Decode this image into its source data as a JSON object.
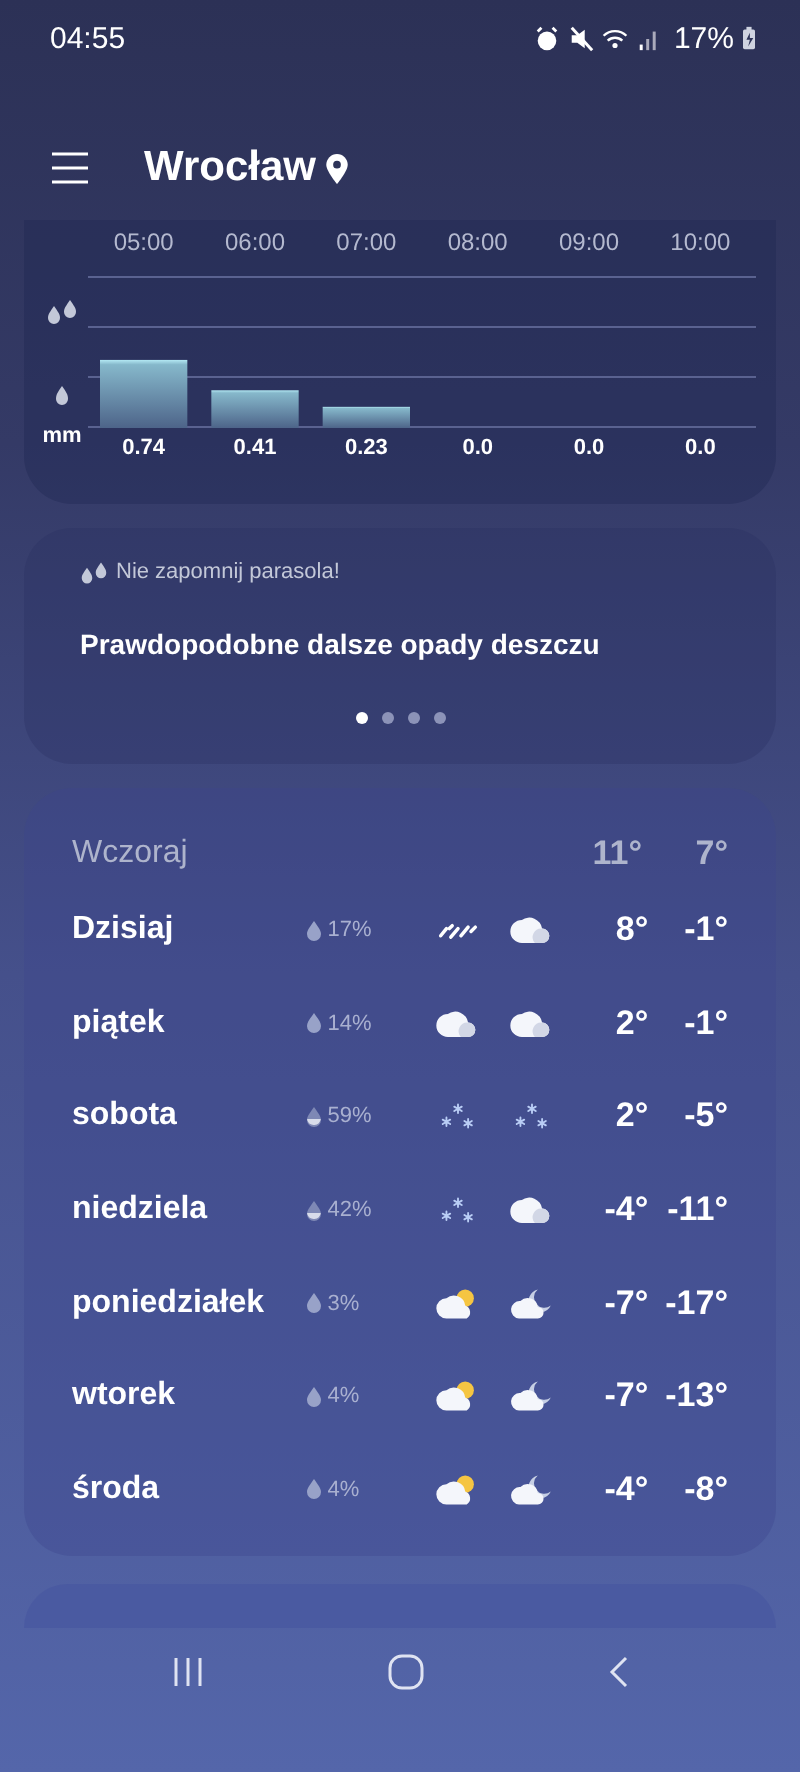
{
  "status_bar": {
    "time": "04:55",
    "battery": "17%"
  },
  "header": {
    "city": "Wrocław"
  },
  "precipitation": {
    "chart_data": {
      "type": "bar",
      "ylabel": "mm",
      "categories": [
        "05:00",
        "06:00",
        "07:00",
        "08:00",
        "09:00",
        "10:00"
      ],
      "values": [
        0.74,
        0.41,
        0.23,
        0.0,
        0.0,
        0.0
      ],
      "value_labels": [
        "0.74",
        "0.41",
        "0.23",
        "0.0",
        "0.0",
        "0.0"
      ],
      "data_labels": true
    }
  },
  "alert": {
    "title": "Nie zapomnij parasola!",
    "message": "Prawdopodobne dalsze opady deszczu",
    "pages": [
      {
        "selected": true
      },
      {
        "selected": false
      },
      {
        "selected": false
      },
      {
        "selected": false
      }
    ]
  },
  "yesterday": {
    "label": "Wczoraj",
    "high": "11°",
    "low": "7°"
  },
  "forecast": [
    {
      "day": "Dzisiaj",
      "precip": {
        "kind": "drop",
        "chance": "17%"
      },
      "day_icon": {
        "kind": "rain"
      },
      "night_icon": {
        "kind": "cloud"
      },
      "high": "8°",
      "low": "-1°"
    },
    {
      "day": "piątek",
      "precip": {
        "kind": "drop",
        "chance": "14%"
      },
      "day_icon": {
        "kind": "cloud"
      },
      "night_icon": {
        "kind": "cloud"
      },
      "high": "2°",
      "low": "-1°"
    },
    {
      "day": "sobota",
      "precip": {
        "kind": "half-drop",
        "chance": "59%"
      },
      "day_icon": {
        "kind": "snow"
      },
      "night_icon": {
        "kind": "snow"
      },
      "high": "2°",
      "low": "-5°"
    },
    {
      "day": "niedziela",
      "precip": {
        "kind": "half-drop",
        "chance": "42%"
      },
      "day_icon": {
        "kind": "snow"
      },
      "night_icon": {
        "kind": "cloud"
      },
      "high": "-4°",
      "low": "-11°"
    },
    {
      "day": "poniedziałek",
      "precip": {
        "kind": "drop",
        "chance": "3%"
      },
      "day_icon": {
        "kind": "sun-cloud"
      },
      "night_icon": {
        "kind": "moon-cloud"
      },
      "high": "-7°",
      "low": "-17°"
    },
    {
      "day": "wtorek",
      "precip": {
        "kind": "drop",
        "chance": "4%"
      },
      "day_icon": {
        "kind": "sun-cloud"
      },
      "night_icon": {
        "kind": "moon-cloud"
      },
      "high": "-7°",
      "low": "-13°"
    },
    {
      "day": "środa",
      "precip": {
        "kind": "drop",
        "chance": "4%"
      },
      "day_icon": {
        "kind": "sun-cloud"
      },
      "night_icon": {
        "kind": "moon-cloud"
      },
      "high": "-4°",
      "low": "-8°"
    }
  ]
}
